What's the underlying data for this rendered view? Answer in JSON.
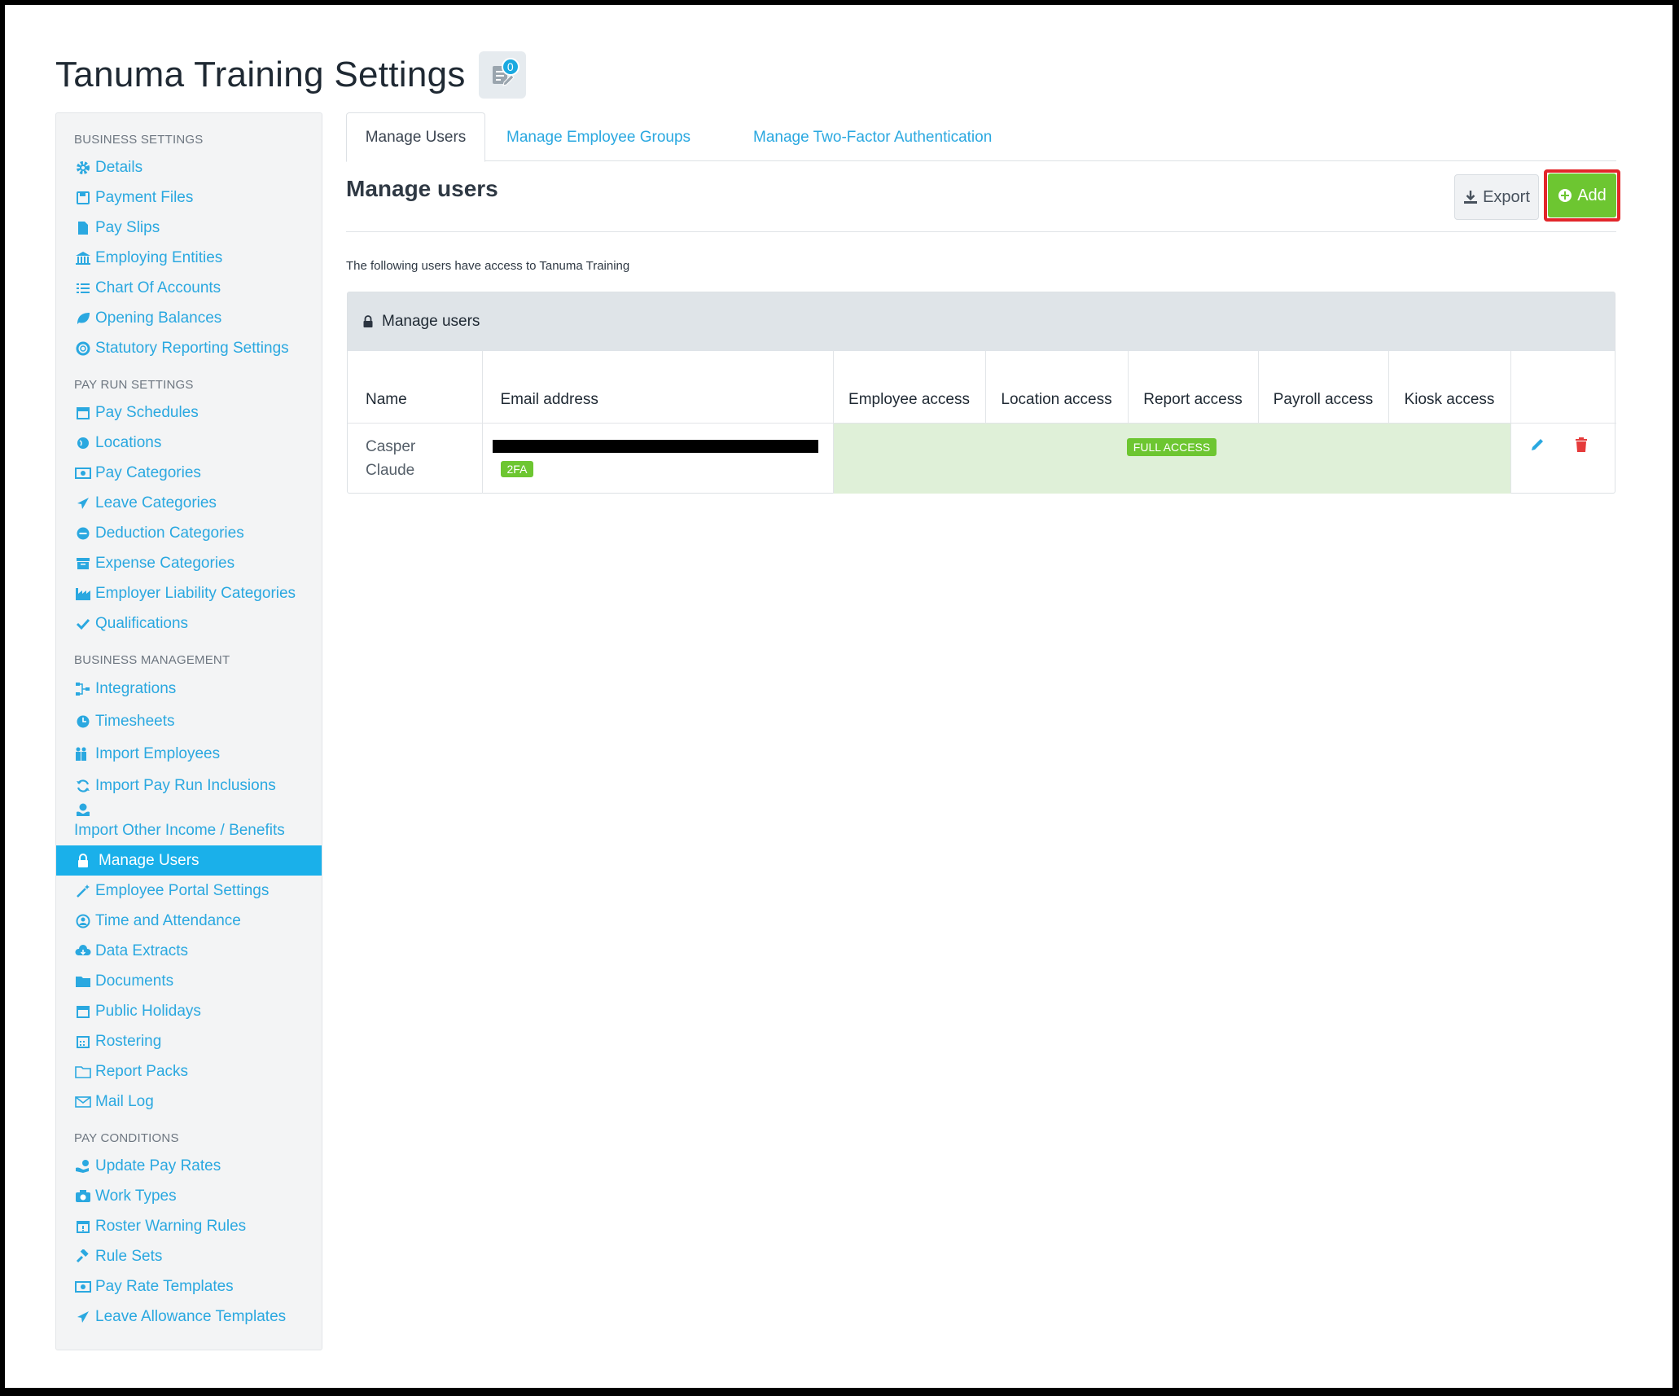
{
  "page": {
    "title": "Tanuma Training Settings",
    "notification_count": "0"
  },
  "colors": {
    "accent": "#2aa8e0",
    "active_bg": "#1ab0ea",
    "success": "#6dc631",
    "highlight_border": "#e2262a"
  },
  "sidebar": {
    "sections": [
      {
        "heading": "BUSINESS SETTINGS",
        "items": [
          {
            "label": "Details",
            "icon": "gear-icon"
          },
          {
            "label": "Payment Files",
            "icon": "floppy-disk-icon"
          },
          {
            "label": "Pay Slips",
            "icon": "file-icon"
          },
          {
            "label": "Employing Entities",
            "icon": "bank-icon"
          },
          {
            "label": "Chart Of Accounts",
            "icon": "list-icon"
          },
          {
            "label": "Opening Balances",
            "icon": "leaf-icon"
          },
          {
            "label": "Statutory Reporting Settings",
            "icon": "lifebuoy-icon"
          }
        ]
      },
      {
        "heading": "PAY RUN SETTINGS",
        "items": [
          {
            "label": "Pay Schedules",
            "icon": "calendar-icon"
          },
          {
            "label": "Locations",
            "icon": "globe-icon"
          },
          {
            "label": "Pay Categories",
            "icon": "money-icon"
          },
          {
            "label": "Leave Categories",
            "icon": "plane-icon"
          },
          {
            "label": "Deduction Categories",
            "icon": "minus-circle-icon"
          },
          {
            "label": "Expense Categories",
            "icon": "archive-icon"
          },
          {
            "label": "Employer Liability Categories",
            "icon": "industry-icon"
          },
          {
            "label": "Qualifications",
            "icon": "check-icon"
          }
        ]
      },
      {
        "heading": "BUSINESS MANAGEMENT",
        "items": [
          {
            "label": "Integrations",
            "icon": "sitemap-icon"
          },
          {
            "label": "Timesheets",
            "icon": "clock-icon"
          },
          {
            "label": "Import Employees",
            "icon": "users-icon"
          },
          {
            "label": "Import Pay Run Inclusions",
            "icon": "refresh-icon"
          },
          {
            "label": "Import Other Income / Benefits",
            "icon": "hand-coins-icon"
          },
          {
            "label": "Manage Users",
            "icon": "lock-icon",
            "active": true
          },
          {
            "label": "Employee Portal Settings",
            "icon": "magic-wand-icon"
          },
          {
            "label": "Time and Attendance",
            "icon": "user-circle-icon"
          },
          {
            "label": "Data Extracts",
            "icon": "cloud-download-icon"
          },
          {
            "label": "Documents",
            "icon": "folder-icon"
          },
          {
            "label": "Public Holidays",
            "icon": "calendar-icon"
          },
          {
            "label": "Rostering",
            "icon": "calendar-grid-icon"
          },
          {
            "label": "Report Packs",
            "icon": "folder-open-icon"
          },
          {
            "label": "Mail Log",
            "icon": "envelope-icon"
          }
        ]
      },
      {
        "heading": "PAY CONDITIONS",
        "items": [
          {
            "label": "Update Pay Rates",
            "icon": "hand-money-icon"
          },
          {
            "label": "Work Types",
            "icon": "camera-icon"
          },
          {
            "label": "Roster Warning Rules",
            "icon": "calendar-alert-icon"
          },
          {
            "label": "Rule Sets",
            "icon": "gavel-icon"
          },
          {
            "label": "Pay Rate Templates",
            "icon": "money-icon"
          },
          {
            "label": "Leave Allowance Templates",
            "icon": "plane-icon"
          }
        ]
      }
    ]
  },
  "tabs": [
    {
      "label": "Manage Users",
      "active": true
    },
    {
      "label": "Manage Employee Groups",
      "active": false
    },
    {
      "label": "Manage Two-Factor Authentication",
      "active": false
    }
  ],
  "main": {
    "heading": "Manage users",
    "export_label": "Export",
    "add_label": "Add",
    "intro_text": "The following users have access to Tanuma Training",
    "panel_title": "Manage users"
  },
  "table": {
    "headers": {
      "name": "Name",
      "email": "Email address",
      "employee_access": "Employee access",
      "location_access": "Location access",
      "report_access": "Report access",
      "payroll_access": "Payroll access",
      "kiosk_access": "Kiosk access"
    },
    "rows": [
      {
        "name": "Casper Claude",
        "email_redacted": true,
        "twofa_badge": "2FA",
        "access_badge": "FULL ACCESS"
      }
    ]
  }
}
